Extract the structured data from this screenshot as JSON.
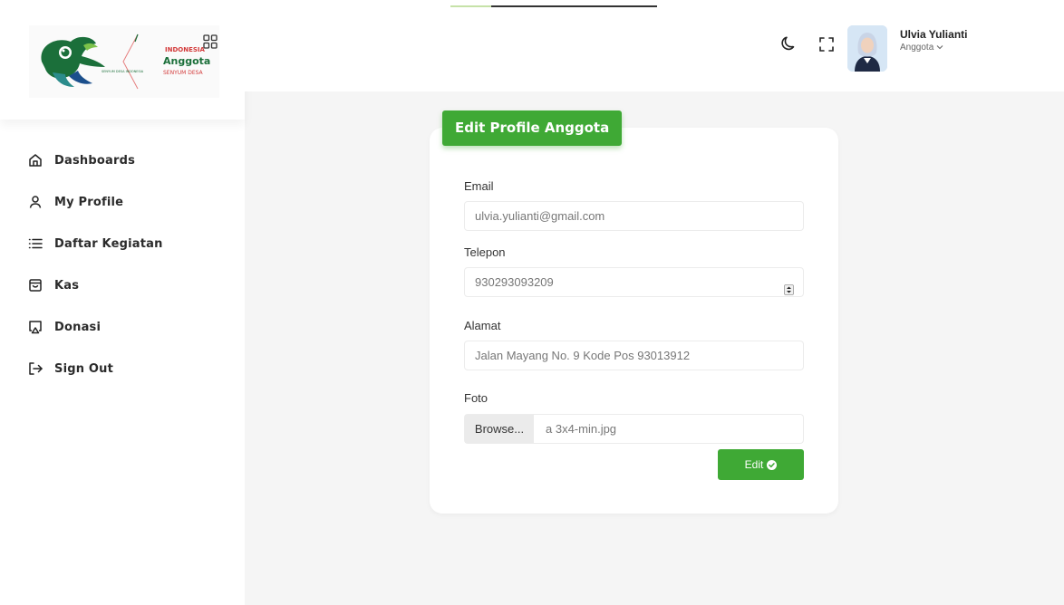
{
  "sidebar": {
    "logo": {
      "line1": "INDONESIA",
      "line2": "Anggota",
      "line3": "SENYUM DESA",
      "small": "SENYUM DESA INDONESIA"
    },
    "items": [
      {
        "label": "Dashboards",
        "icon": "home-icon"
      },
      {
        "label": "My Profile",
        "icon": "user-icon"
      },
      {
        "label": "Daftar Kegiatan",
        "icon": "list-icon"
      },
      {
        "label": "Kas",
        "icon": "bag-icon"
      },
      {
        "label": "Donasi",
        "icon": "cast-icon"
      },
      {
        "label": "Sign Out",
        "icon": "sign-out-icon"
      }
    ]
  },
  "header": {
    "user_name": "Ulvia Yulianti",
    "user_role": "Anggota"
  },
  "form": {
    "title": "Edit Profile Anggota",
    "email_label": "Email",
    "email_value": "ulvia.yulianti@gmail.com",
    "phone_label": "Telepon",
    "phone_value": "930293093209",
    "address_label": "Alamat",
    "address_value": "Jalan Mayang No. 9 Kode Pos 93013912",
    "photo_label": "Foto",
    "browse_label": "Browse...",
    "file_name": "a 3x4-min.jpg",
    "submit_label": "Edit"
  },
  "colors": {
    "accent": "#3fa935",
    "background": "#f5f5f5"
  }
}
